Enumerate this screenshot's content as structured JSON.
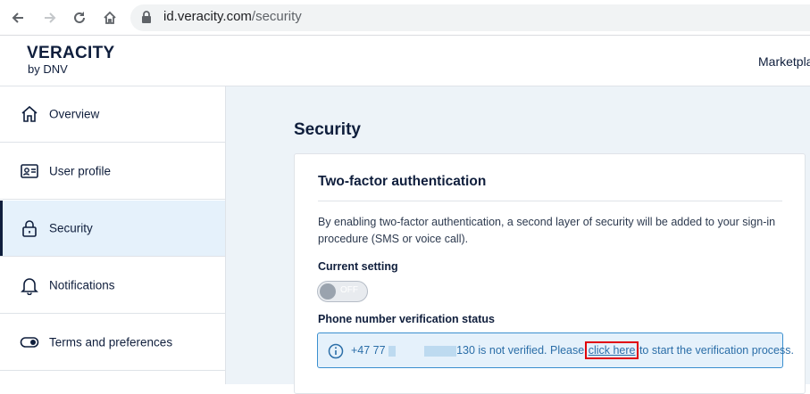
{
  "browser": {
    "url_host": "id.veracity.com",
    "url_path": "/security"
  },
  "header": {
    "logo_main": "VERACITY",
    "logo_sub": "by DNV",
    "marketplace": "Marketpla"
  },
  "sidebar": {
    "items": [
      {
        "label": "Overview",
        "icon": "home-icon"
      },
      {
        "label": "User profile",
        "icon": "id-card-icon"
      },
      {
        "label": "Security",
        "icon": "lock-icon",
        "active": true
      },
      {
        "label": "Notifications",
        "icon": "bell-icon"
      },
      {
        "label": "Terms and preferences",
        "icon": "toggle-icon"
      }
    ]
  },
  "main": {
    "title": "Security",
    "card": {
      "title": "Two-factor authentication",
      "description": "By enabling two-factor authentication, a second layer of security will be added to your sign-in procedure (SMS or voice call).",
      "current_setting_label": "Current setting",
      "toggle_text": "OFF",
      "toggle_on": false,
      "phone_status_label": "Phone number verification status",
      "info": {
        "prefix": "+47 77 ",
        "suffix": "130 is not verified. Please ",
        "link": "click here",
        "after": " to start the verification process."
      }
    }
  },
  "colors": {
    "accent": "#0f1e3c",
    "info_bg": "#e5f1fb",
    "info_border": "#3a8fcf",
    "highlight": "#e0000a"
  }
}
